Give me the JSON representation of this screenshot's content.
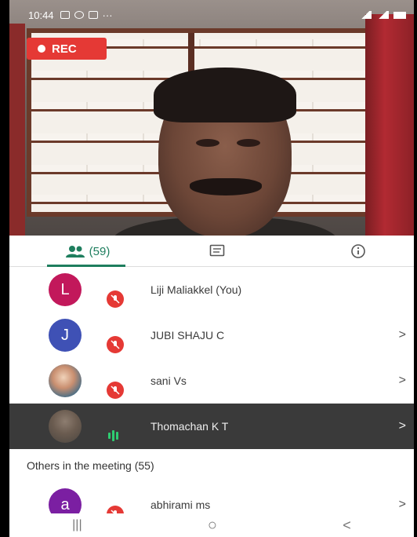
{
  "statusbar": {
    "time": "10:44",
    "dots": "···"
  },
  "video": {
    "rec_label": "REC"
  },
  "tabs": {
    "people_count": "(59)"
  },
  "participants": [
    {
      "initial": "L",
      "name": "Liji Maliakkel (You)",
      "avatar_color": "#c2185b",
      "avatar_type": "letter",
      "state": "muted",
      "chevron": ""
    },
    {
      "initial": "J",
      "name": "JUBI SHAJU C",
      "avatar_color": "#3f51b5",
      "avatar_type": "letter",
      "state": "muted",
      "chevron": ">"
    },
    {
      "initial": "",
      "name": "sani Vs",
      "avatar_color": "",
      "avatar_type": "photo",
      "state": "muted",
      "chevron": ">"
    },
    {
      "initial": "",
      "name": "Thomachan K T",
      "avatar_color": "",
      "avatar_type": "photo",
      "state": "speaking",
      "chevron": ">"
    }
  ],
  "others": {
    "header": "Others in the meeting (55)",
    "items": [
      {
        "initial": "a",
        "name": "abhirami ms",
        "avatar_color": "#7b1fa2",
        "avatar_type": "letter",
        "state": "muted",
        "chevron": ">"
      }
    ]
  },
  "navbar": {
    "recents": "|||",
    "home": "○",
    "back": "<"
  },
  "colors": {
    "accent": "#1e7e5e",
    "rec": "#e53935",
    "mute": "#e53935",
    "speaking": "#2ecc71"
  }
}
